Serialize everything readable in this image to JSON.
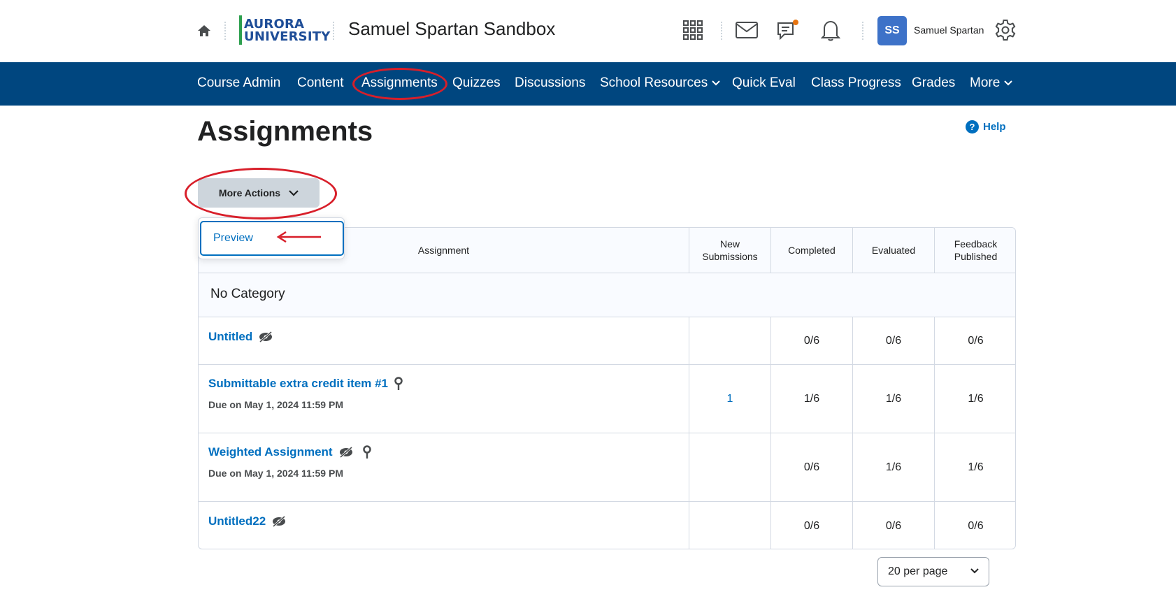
{
  "header": {
    "logo_line1": "AURORA",
    "logo_line2": "UNIVERSITY",
    "course_title": "Samuel Spartan Sandbox",
    "user_initials": "SS",
    "user_name": "Samuel Spartan",
    "icons": [
      "home-icon",
      "apps-grid-icon",
      "mail-icon",
      "chat-icon",
      "bell-icon",
      "gear-icon"
    ]
  },
  "nav": {
    "items": [
      "Course Admin",
      "Content",
      "Assignments",
      "Quizzes",
      "Discussions",
      "School Resources",
      "Quick Eval",
      "Class Progress",
      "Grades",
      "More"
    ]
  },
  "page": {
    "title": "Assignments",
    "help_label": "Help",
    "more_actions_label": "More Actions",
    "dropdown_item": "Preview"
  },
  "table": {
    "headers": {
      "assignment": "Assignment",
      "new_submissions_l1": "New",
      "new_submissions_l2": "Submissions",
      "completed": "Completed",
      "evaluated": "Evaluated",
      "feedback_l1": "Feedback",
      "feedback_l2": "Published"
    },
    "category": "No Category",
    "rows": [
      {
        "name": "Untitled",
        "due": "",
        "new": "",
        "completed": "0/6",
        "evaluated": "0/6",
        "feedback": "0/6"
      },
      {
        "name": "Submittable extra credit item #1",
        "due": "Due on May 1, 2024 11:59 PM",
        "new": "1",
        "completed": "1/6",
        "evaluated": "1/6",
        "feedback": "1/6"
      },
      {
        "name": "Weighted Assignment",
        "due": "Due on May 1, 2024 11:59 PM",
        "new": "",
        "completed": "0/6",
        "evaluated": "1/6",
        "feedback": "1/6"
      },
      {
        "name": "Untitled22",
        "due": "",
        "new": "",
        "completed": "0/6",
        "evaluated": "0/6",
        "feedback": "0/6"
      }
    ]
  },
  "pagination": {
    "per_page": "20 per page"
  },
  "colors": {
    "nav_bg": "#00467f",
    "link": "#006fbf",
    "annotation": "#d81f2a",
    "avatar": "#3d72c8"
  }
}
